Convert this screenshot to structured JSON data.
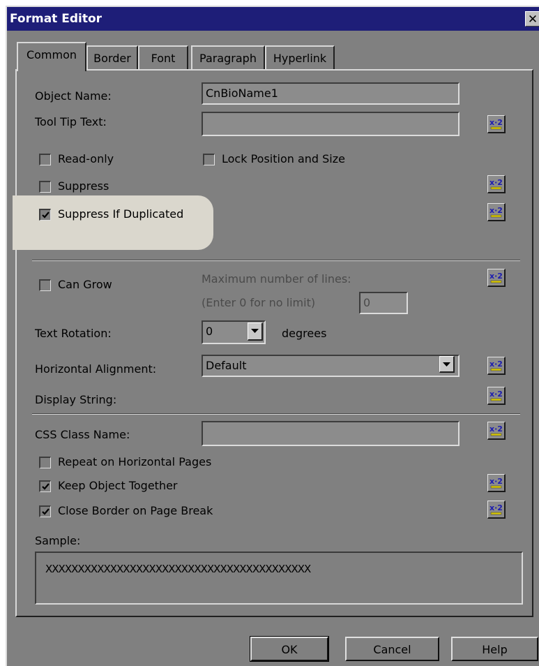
{
  "window": {
    "title": "Format Editor",
    "close_glyph": "✕"
  },
  "tabs": [
    {
      "label": "Common",
      "active": true
    },
    {
      "label": "Border"
    },
    {
      "label": "Font"
    },
    {
      "label": "Paragraph"
    },
    {
      "label": "Hyperlink"
    }
  ],
  "fields": {
    "object_name": {
      "label": "Object Name:",
      "value": "CnBioName1"
    },
    "tooltip": {
      "label": "Tool Tip Text:",
      "value": ""
    },
    "read_only": {
      "label": "Read-only",
      "checked": false
    },
    "lock_position": {
      "label": "Lock Position and Size",
      "checked": false
    },
    "suppress": {
      "label": "Suppress",
      "checked": false
    },
    "suppress_dup": {
      "label": "Suppress If Duplicated",
      "checked": true
    },
    "can_grow": {
      "label": "Can Grow",
      "checked": false
    },
    "max_lines_label": "Maximum number of lines:",
    "max_lines_hint": "(Enter 0 for no limit)",
    "max_lines_value": "0",
    "text_rotation": {
      "label": "Text Rotation:",
      "value": "0",
      "unit": "degrees"
    },
    "horizontal_alignment": {
      "label": "Horizontal Alignment:",
      "value": "Default"
    },
    "display_string": {
      "label": "Display String:"
    },
    "css_class": {
      "label": "CSS Class Name:",
      "value": ""
    },
    "repeat_horizontal": {
      "label": "Repeat on Horizontal Pages",
      "checked": false
    },
    "keep_together": {
      "label": "Keep Object Together",
      "checked": true
    },
    "close_border": {
      "label": "Close Border on Page Break",
      "checked": true
    },
    "sample": {
      "label": "Sample:",
      "value": "XXXXXXXXXXXXXXXXXXXXXXXXXXXXXXXXXXXXXXXXX"
    }
  },
  "buttons": {
    "ok": "OK",
    "cancel": "Cancel",
    "help": "Help"
  },
  "icons": {
    "formula": "formula-x2-icon",
    "checkmark": "checkmark-icon",
    "dropdown": "dropdown-arrow-icon"
  },
  "colors": {
    "titlebar": "#1e1e78",
    "dialog_bg": "#808080",
    "highlight": "#dad7cd"
  }
}
